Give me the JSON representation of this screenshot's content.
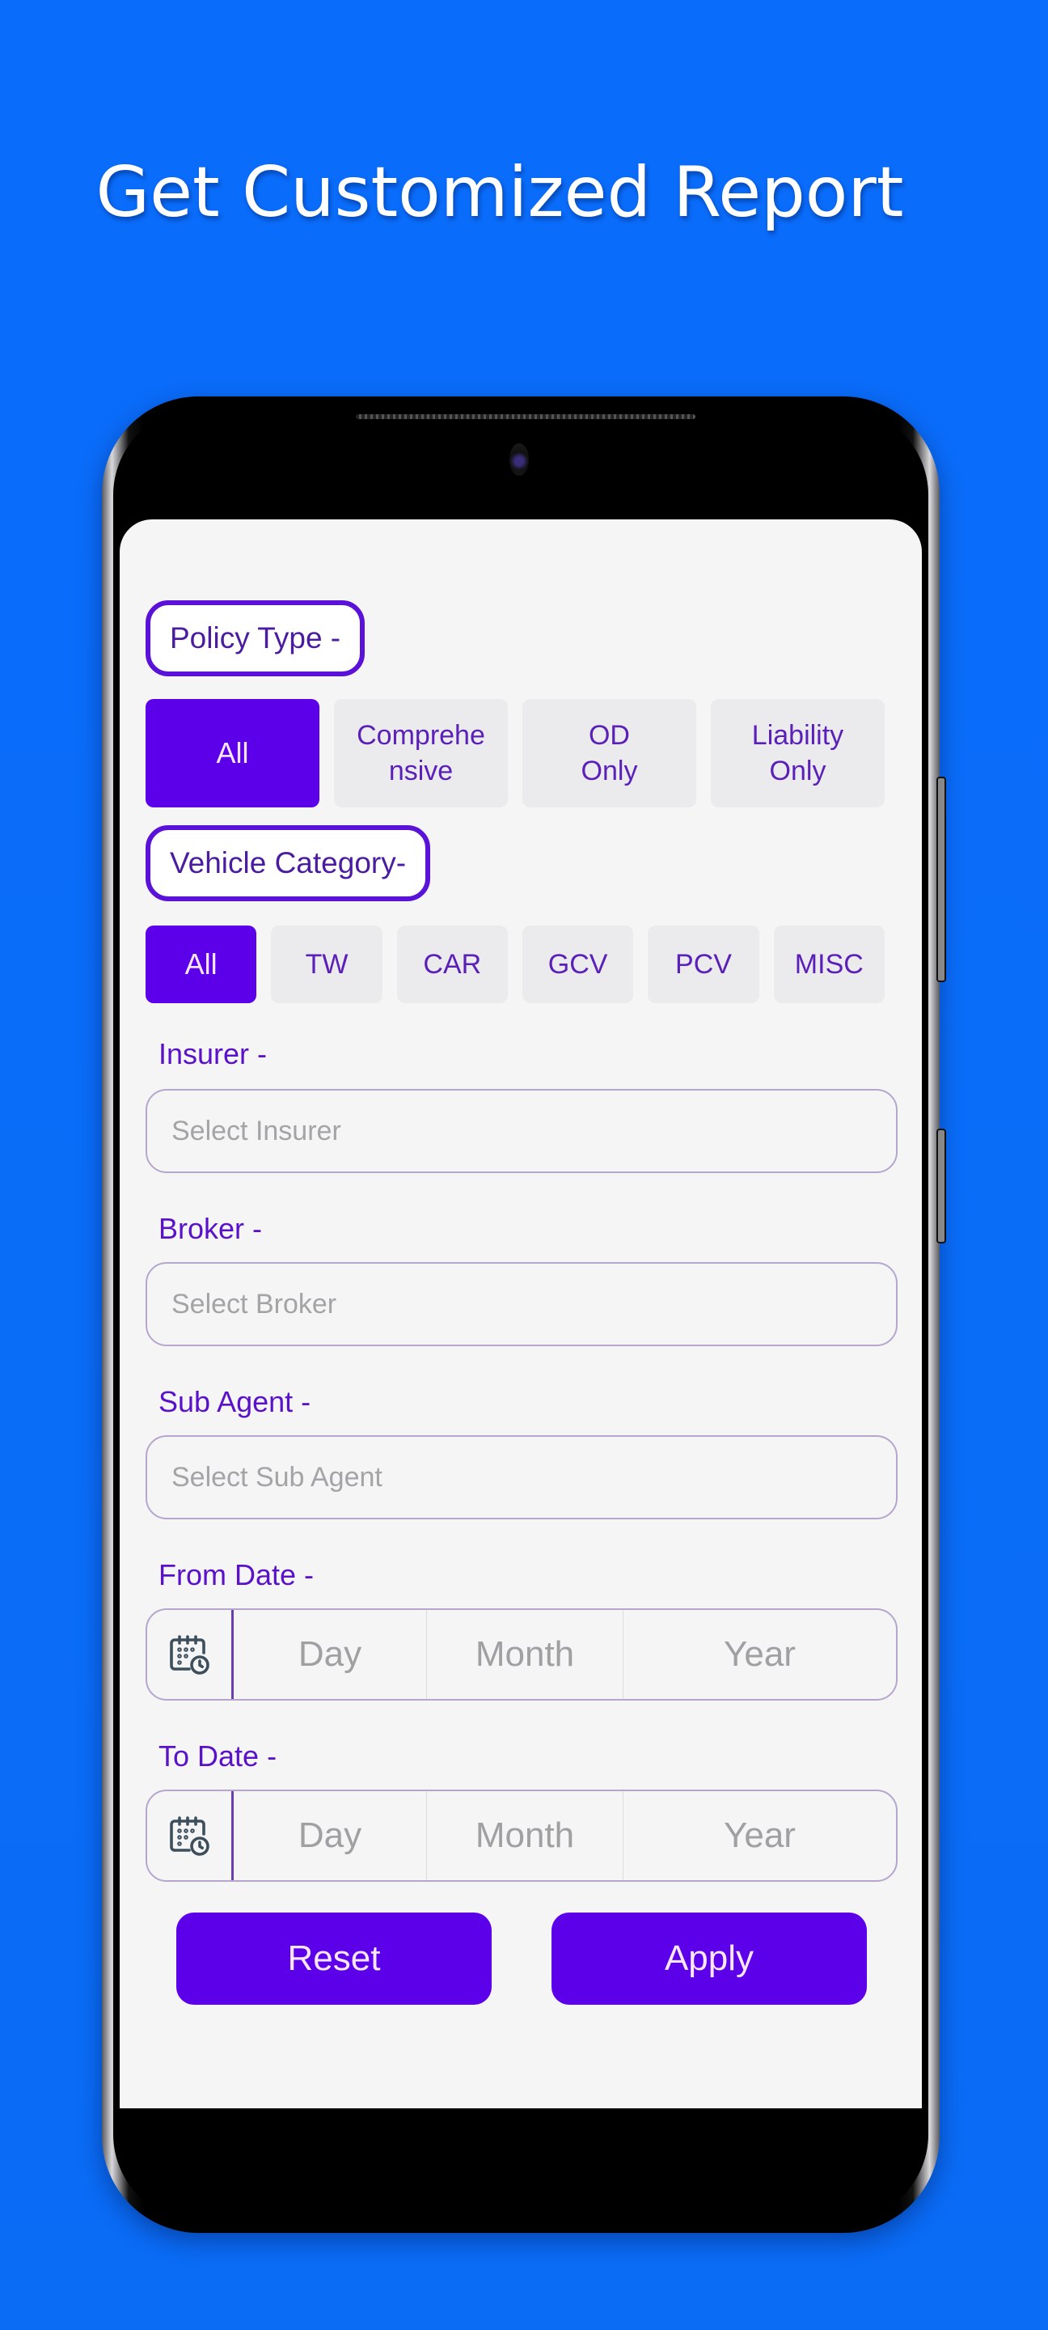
{
  "headline": "Get Customized Report",
  "colors": {
    "background": "#0a6cfb",
    "accent": "#5d00ea",
    "label": "#5a12c8",
    "placeholder": "#a4a4a6"
  },
  "policy_type": {
    "label": "Policy Type -",
    "options": [
      {
        "label": "All",
        "selected": true
      },
      {
        "label": "Comprehe nsive",
        "selected": false
      },
      {
        "label": "OD Only",
        "selected": false
      },
      {
        "label": "Liability Only",
        "selected": false
      }
    ]
  },
  "vehicle_category": {
    "label": "Vehicle Category-",
    "options": [
      {
        "label": "All",
        "selected": true
      },
      {
        "label": "TW",
        "selected": false
      },
      {
        "label": "CAR",
        "selected": false
      },
      {
        "label": "GCV",
        "selected": false
      },
      {
        "label": "PCV",
        "selected": false
      },
      {
        "label": "MISC",
        "selected": false
      }
    ]
  },
  "insurer": {
    "label": "Insurer -",
    "placeholder": "Select Insurer",
    "icon": "calendar-icon"
  },
  "broker": {
    "label": "Broker -",
    "placeholder": "Select Broker"
  },
  "sub_agent": {
    "label": "Sub Agent -",
    "placeholder": "Select Sub Agent"
  },
  "from_date": {
    "label": "From Date -",
    "icon": "calendar-clock-icon",
    "day": "Day",
    "month": "Month",
    "year": "Year"
  },
  "to_date": {
    "label": "To Date -",
    "icon": "calendar-clock-icon",
    "day": "Day",
    "month": "Month",
    "year": "Year"
  },
  "actions": {
    "reset": "Reset",
    "apply": "Apply"
  }
}
